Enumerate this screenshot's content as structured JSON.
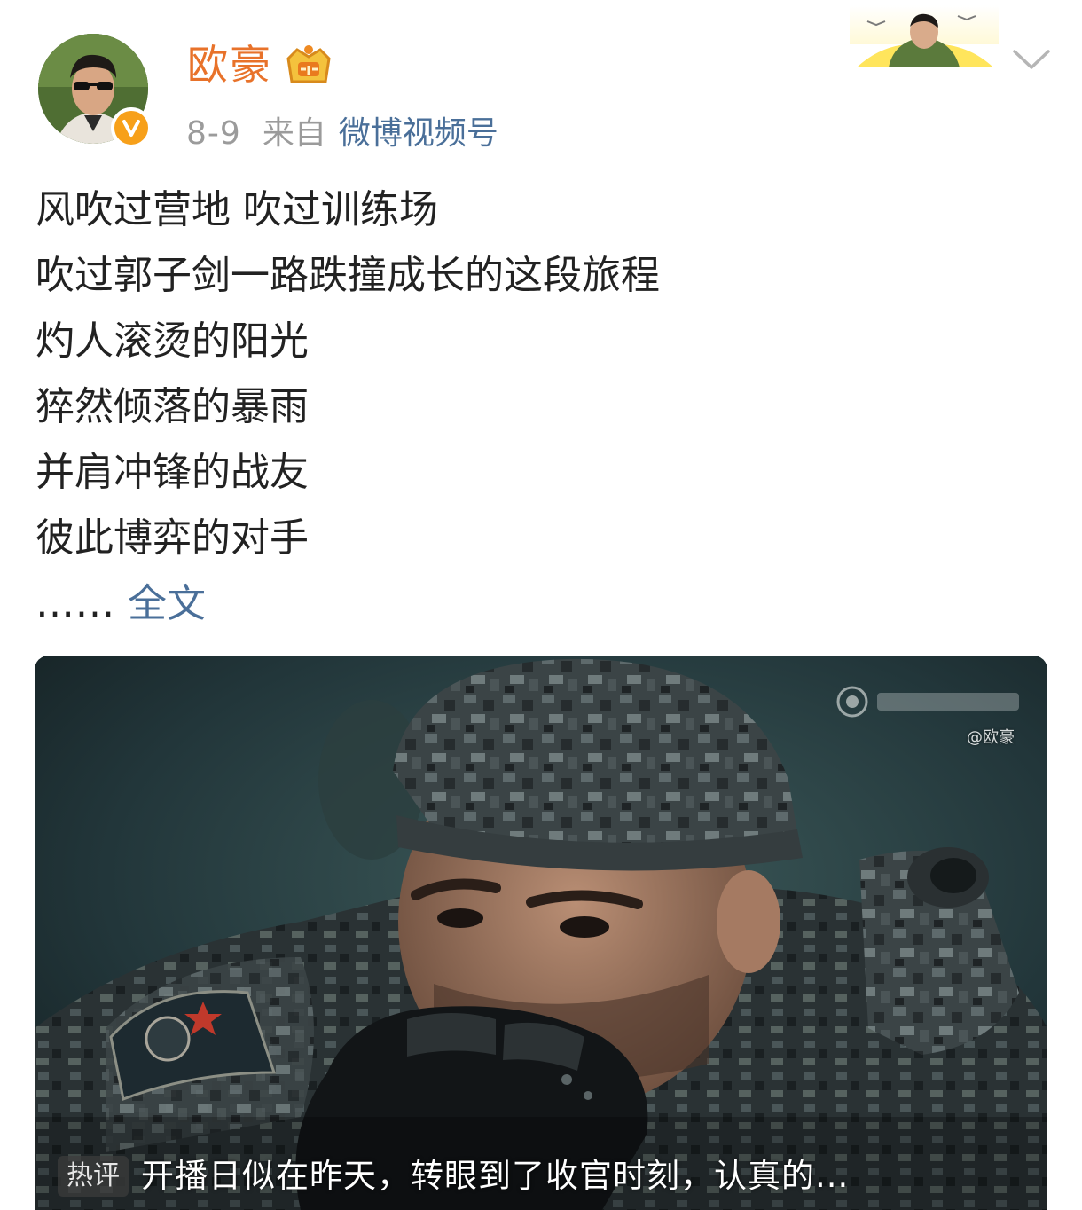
{
  "post": {
    "author": "欧豪",
    "date": "8-9",
    "from_label": "来自",
    "source": "微博视频号",
    "lines": [
      "风吹过营地 吹过训练场",
      "吹过郭子剑一路跌撞成长的这段旅程",
      "灼人滚烫的阳光",
      "猝然倾落的暴雨",
      "并肩冲锋的战友",
      "彼此博弈的对手"
    ],
    "ellipsis": "…...",
    "full_text_label": "全文"
  },
  "icons": {
    "verified": "verified-v-icon",
    "level": "user-level-crown-icon",
    "expand": "chevron-down-icon"
  },
  "video": {
    "watermark_user": "@欧豪",
    "hot_comment_tag": "热评",
    "hot_comment_text": "开播日似在昨天，转眼到了收官时刻，认真的..."
  },
  "colors": {
    "username": "#e8722a",
    "link": "#4a6f99",
    "meta": "#9b9b9b",
    "verified": "#f7a01a"
  }
}
